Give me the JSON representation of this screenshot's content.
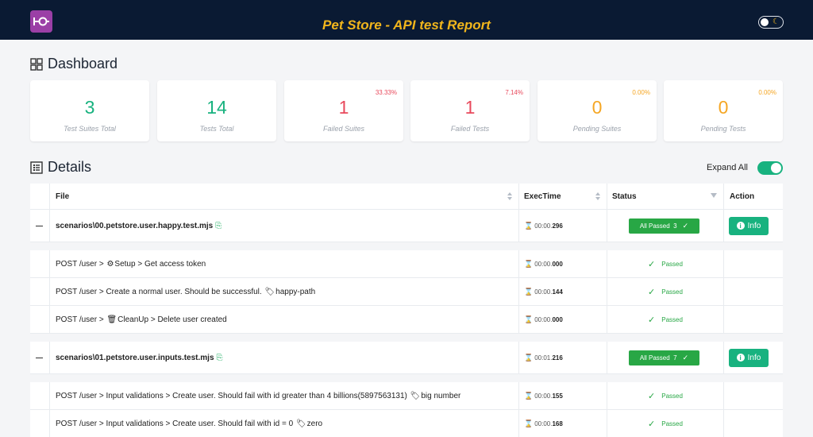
{
  "header": {
    "title": "Pet Store - API test Report"
  },
  "dashboard": {
    "title": "Dashboard",
    "cards": [
      {
        "value": "3",
        "label": "Test Suites Total",
        "pct": "",
        "color": "#18b27f"
      },
      {
        "value": "14",
        "label": "Tests Total",
        "pct": "",
        "color": "#18b27f"
      },
      {
        "value": "1",
        "label": "Failed Suites",
        "pct": "33.33%",
        "color": "#e8495c"
      },
      {
        "value": "1",
        "label": "Failed Tests",
        "pct": "7.14%",
        "color": "#e8495c"
      },
      {
        "value": "0",
        "label": "Pending Suites",
        "pct": "0.00%",
        "color": "#f5a623"
      },
      {
        "value": "0",
        "label": "Pending Tests",
        "pct": "0.00%",
        "color": "#f5a623"
      }
    ]
  },
  "details": {
    "title": "Details",
    "expand_all_label": "Expand All",
    "columns": {
      "file": "File",
      "exectime": "ExecTime",
      "status": "Status",
      "action": "Action"
    },
    "suites": [
      {
        "name": "scenarios\\00.petstore.user.happy.test.mjs",
        "time_prefix": "00:00.",
        "time_ms": "296",
        "status_label": "All Passed",
        "status_count": "3",
        "action_label": "Info",
        "tests": [
          {
            "name_a": "POST /user > ",
            "emoji": "⚙",
            "name_b": "Setup > Get access token",
            "tag_emoji": "",
            "tag": "",
            "time_prefix": "00:00.",
            "time_ms": "000",
            "status": "Passed"
          },
          {
            "name_a": "POST /user > Create a normal user. Should be successful. ",
            "emoji": "",
            "name_b": "",
            "tag_emoji": "🏷",
            "tag": "happy-path",
            "time_prefix": "00:00.",
            "time_ms": "144",
            "status": "Passed"
          },
          {
            "name_a": "POST /user > ",
            "emoji": "🗑",
            "name_b": "CleanUp > Delete user created",
            "tag_emoji": "",
            "tag": "",
            "time_prefix": "00:00.",
            "time_ms": "000",
            "status": "Passed"
          }
        ]
      },
      {
        "name": "scenarios\\01.petstore.user.inputs.test.mjs",
        "time_prefix": "00:01.",
        "time_ms": "216",
        "status_label": "All Passed",
        "status_count": "7",
        "action_label": "Info",
        "tests": [
          {
            "name_a": "POST /user > Input validations > Create user. Should fail with id greater than 4 billions(5897563131) ",
            "emoji": "",
            "name_b": "",
            "tag_emoji": "🏷",
            "tag": "big number",
            "time_prefix": "00:00.",
            "time_ms": "155",
            "status": "Passed"
          },
          {
            "name_a": "POST /user > Input validations > Create user. Should fail with id = 0 ",
            "emoji": "",
            "name_b": "",
            "tag_emoji": "🏷",
            "tag": "zero",
            "time_prefix": "00:00.",
            "time_ms": "168",
            "status": "Passed"
          }
        ]
      }
    ]
  },
  "colors": {
    "header_bg": "#0a1a33",
    "title": "#f0b51c",
    "accent": "#18b27f",
    "passed": "#28a745",
    "failed": "#e8495c",
    "pending": "#f5a623"
  }
}
